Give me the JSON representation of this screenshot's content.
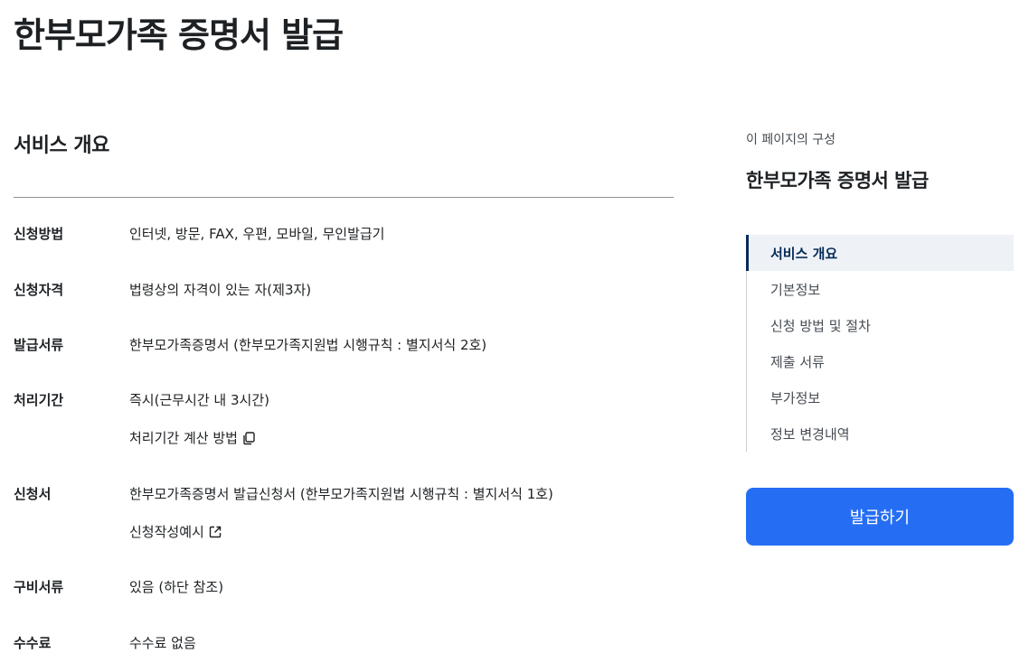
{
  "page": {
    "title": "한부모가족 증명서 발급"
  },
  "main": {
    "section_title": "서비스 개요",
    "rows": [
      {
        "label": "신청방법",
        "value": "인터넷, 방문, FAX, 우편, 모바일, 무인발급기"
      },
      {
        "label": "신청자격",
        "value": "법령상의 자격이 있는 자(제3자)"
      },
      {
        "label": "발급서류",
        "value": "한부모가족증명서 (한부모가족지원법 시행규칙 : 별지서식 2호)"
      },
      {
        "label": "처리기간",
        "value": "즉시(근무시간 내 3시간)",
        "link": "처리기간 계산 방법",
        "link_icon": "copy-icon"
      },
      {
        "label": "신청서",
        "value": "한부모가족증명서 발급신청서 (한부모가족지원법 시행규칙 : 별지서식 1호)",
        "link": "신청작성예시",
        "link_icon": "external-link-icon"
      },
      {
        "label": "구비서류",
        "value": "있음 (하단 참조)"
      },
      {
        "label": "수수료",
        "value": "수수료 없음"
      }
    ]
  },
  "aside": {
    "caption": "이 페이지의 구성",
    "title": "한부모가족 증명서 발급",
    "toc": [
      {
        "label": "서비스 개요",
        "active": true
      },
      {
        "label": "기본정보",
        "active": false
      },
      {
        "label": "신청 방법 및 절차",
        "active": false
      },
      {
        "label": "제출 서류",
        "active": false
      },
      {
        "label": "부가정보",
        "active": false
      },
      {
        "label": "정보 변경내역",
        "active": false
      }
    ],
    "button_label": "발급하기"
  },
  "colors": {
    "primary": "#256ef4",
    "active_nav": "#052b57",
    "active_bg": "#eef2f7"
  }
}
